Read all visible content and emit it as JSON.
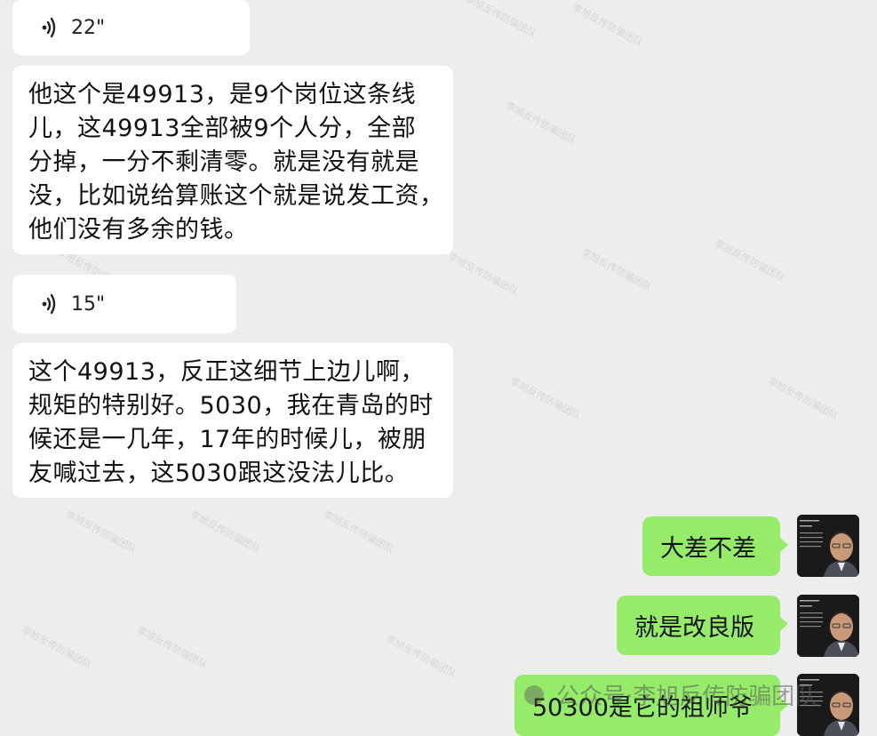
{
  "voice_messages": [
    {
      "duration": "22\""
    },
    {
      "duration": "15\""
    }
  ],
  "received_messages": [
    {
      "lines": [
        "他这个是49913，是9个岗位这条线",
        "儿，这49913全部被9个人分，全部",
        "分掉，一分不剩清零。就是没有就是",
        "没，比如说给算账这个就是说发工资，",
        "他们没有多余的钱。"
      ]
    },
    {
      "lines": [
        "这个49913，反正这细节上边儿啊，",
        "规矩的特别好。5030，我在青岛的时",
        "候还是一几年，17年的时候儿，被朋",
        "友喊过去，这5030跟这没法儿比。"
      ]
    }
  ],
  "sent_messages": [
    {
      "text": "大差不差"
    },
    {
      "text": "就是改良版"
    },
    {
      "text": "50300是它的祖师爷"
    }
  ],
  "watermark_text": "李旭反传防骗团队",
  "overlay_text": "公众号·李旭反传防骗团队",
  "colors": {
    "background": "#ededed",
    "received_bubble": "#ffffff",
    "sent_bubble": "#95ec69"
  }
}
